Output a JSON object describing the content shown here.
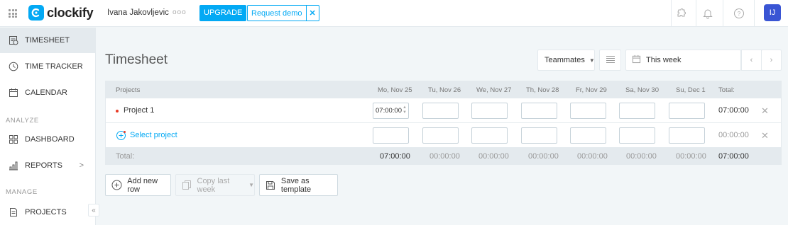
{
  "brand": {
    "name": "clockify",
    "accent": "#03a9f4"
  },
  "topbar": {
    "workspace": "Ivana Jakovljevic",
    "dots": "ooo",
    "upgrade_label": "UPGRADE",
    "demo_label": "Request demo",
    "demo_close": "✕",
    "icons": [
      "apps-icon",
      "extension-icon",
      "bell-icon",
      "help-icon"
    ],
    "avatar_initials": "IJ"
  },
  "sidebar": {
    "items": [
      {
        "label": "TIMESHEET",
        "icon": "timesheet-icon",
        "active": true
      },
      {
        "label": "TIME TRACKER",
        "icon": "clock-icon"
      },
      {
        "label": "CALENDAR",
        "icon": "calendar-icon"
      },
      {
        "label": "DASHBOARD",
        "icon": "dashboard-icon"
      },
      {
        "label": "REPORTS",
        "icon": "reports-icon",
        "chevron": ">"
      },
      {
        "label": "PROJECTS",
        "icon": "projects-icon"
      }
    ],
    "sections": {
      "analyze": "ANALYZE",
      "manage": "MANAGE"
    },
    "collapse": "«"
  },
  "main": {
    "title": "Timesheet",
    "teammates_label": "Teammates",
    "week_label": "This week",
    "nav_prev": "‹",
    "nav_next": "›"
  },
  "table": {
    "header": {
      "projects": "Projects",
      "days": [
        "Mo, Nov 25",
        "Tu, Nov 26",
        "We, Nov 27",
        "Th, Nov 28",
        "Fr, Nov 29",
        "Sa, Nov 30",
        "Su, Dec 1"
      ],
      "total": "Total:"
    },
    "rows": [
      {
        "project": "Project 1",
        "project_color": "#e83a25",
        "cells": [
          "07:00:00",
          "",
          "",
          "",
          "",
          "",
          ""
        ],
        "total": "07:00:00",
        "delete": "✕"
      },
      {
        "project": "Select project",
        "cells": [
          "",
          "",
          "",
          "",
          "",
          "",
          ""
        ],
        "total": "00:00:00",
        "delete": "✕"
      }
    ],
    "footer": {
      "label": "Total:",
      "days": [
        "07:00:00",
        "00:00:00",
        "00:00:00",
        "00:00:00",
        "00:00:00",
        "00:00:00",
        "00:00:00"
      ],
      "total": "07:00:00"
    }
  },
  "actions": {
    "add_row": "Add new row",
    "copy_last_week": "Copy last week",
    "save_template": "Save as template"
  }
}
